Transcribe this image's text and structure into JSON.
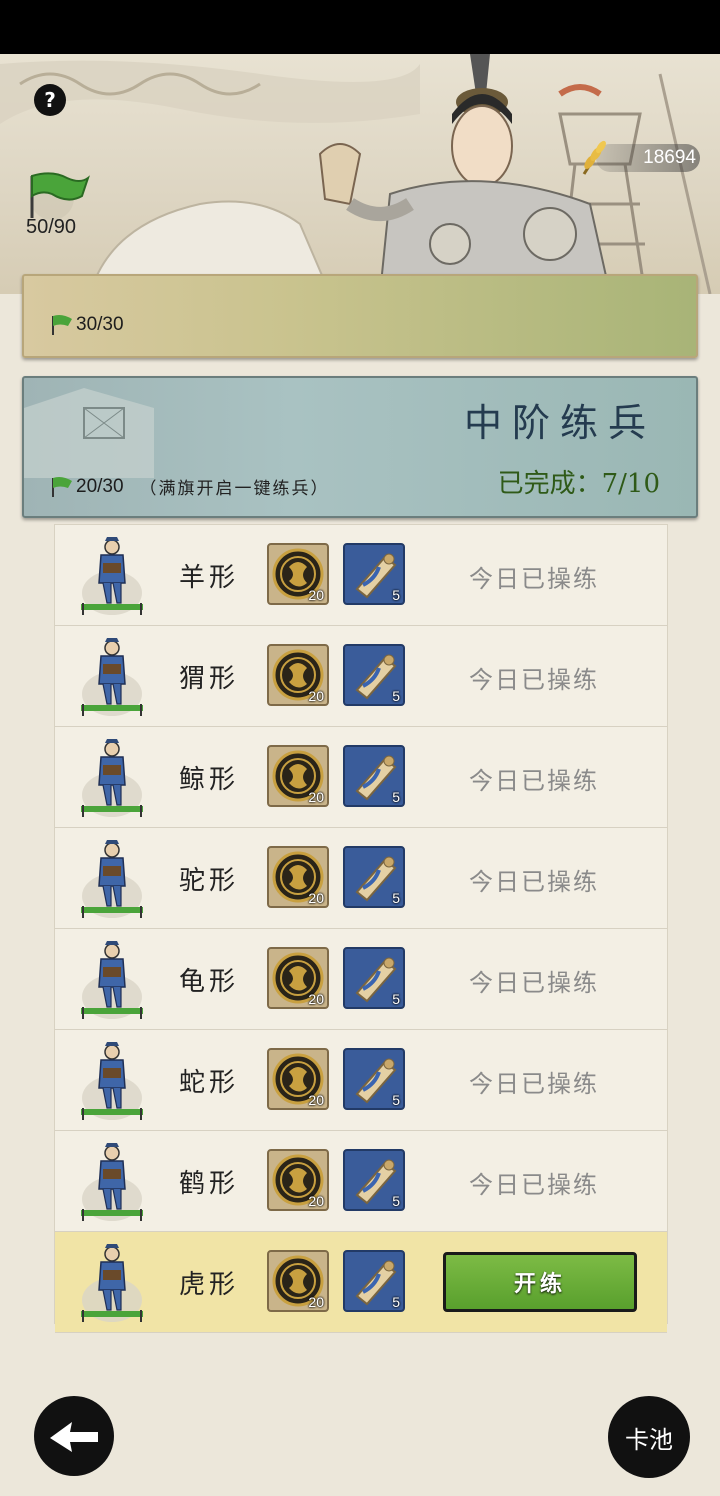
{
  "header": {
    "help_label": "?",
    "flag_count": "50/90",
    "grain_count": "18694"
  },
  "low_training": {
    "flag_count": "30/30"
  },
  "mid_training": {
    "title": "中阶练兵",
    "flag_count": "20/30",
    "hint": "（满旗开启一键练兵）",
    "completed": "已完成：7/10"
  },
  "drills": [
    {
      "name": "羊形",
      "coin_qty": "20",
      "scroll_qty": "5",
      "status": "今日已操练"
    },
    {
      "name": "猬形",
      "coin_qty": "20",
      "scroll_qty": "5",
      "status": "今日已操练"
    },
    {
      "name": "鲸形",
      "coin_qty": "20",
      "scroll_qty": "5",
      "status": "今日已操练"
    },
    {
      "name": "驼形",
      "coin_qty": "20",
      "scroll_qty": "5",
      "status": "今日已操练"
    },
    {
      "name": "龟形",
      "coin_qty": "20",
      "scroll_qty": "5",
      "status": "今日已操练"
    },
    {
      "name": "蛇形",
      "coin_qty": "20",
      "scroll_qty": "5",
      "status": "今日已操练"
    },
    {
      "name": "鹤形",
      "coin_qty": "20",
      "scroll_qty": "5",
      "status": "今日已操练"
    },
    {
      "name": "虎形",
      "coin_qty": "20",
      "scroll_qty": "5",
      "button": "开练"
    }
  ],
  "footer": {
    "card_pool_label": "卡池"
  },
  "colors": {
    "button_green": "#6aae38",
    "active_row": "#f1e4a6",
    "status_grey": "#8a8a8a"
  }
}
